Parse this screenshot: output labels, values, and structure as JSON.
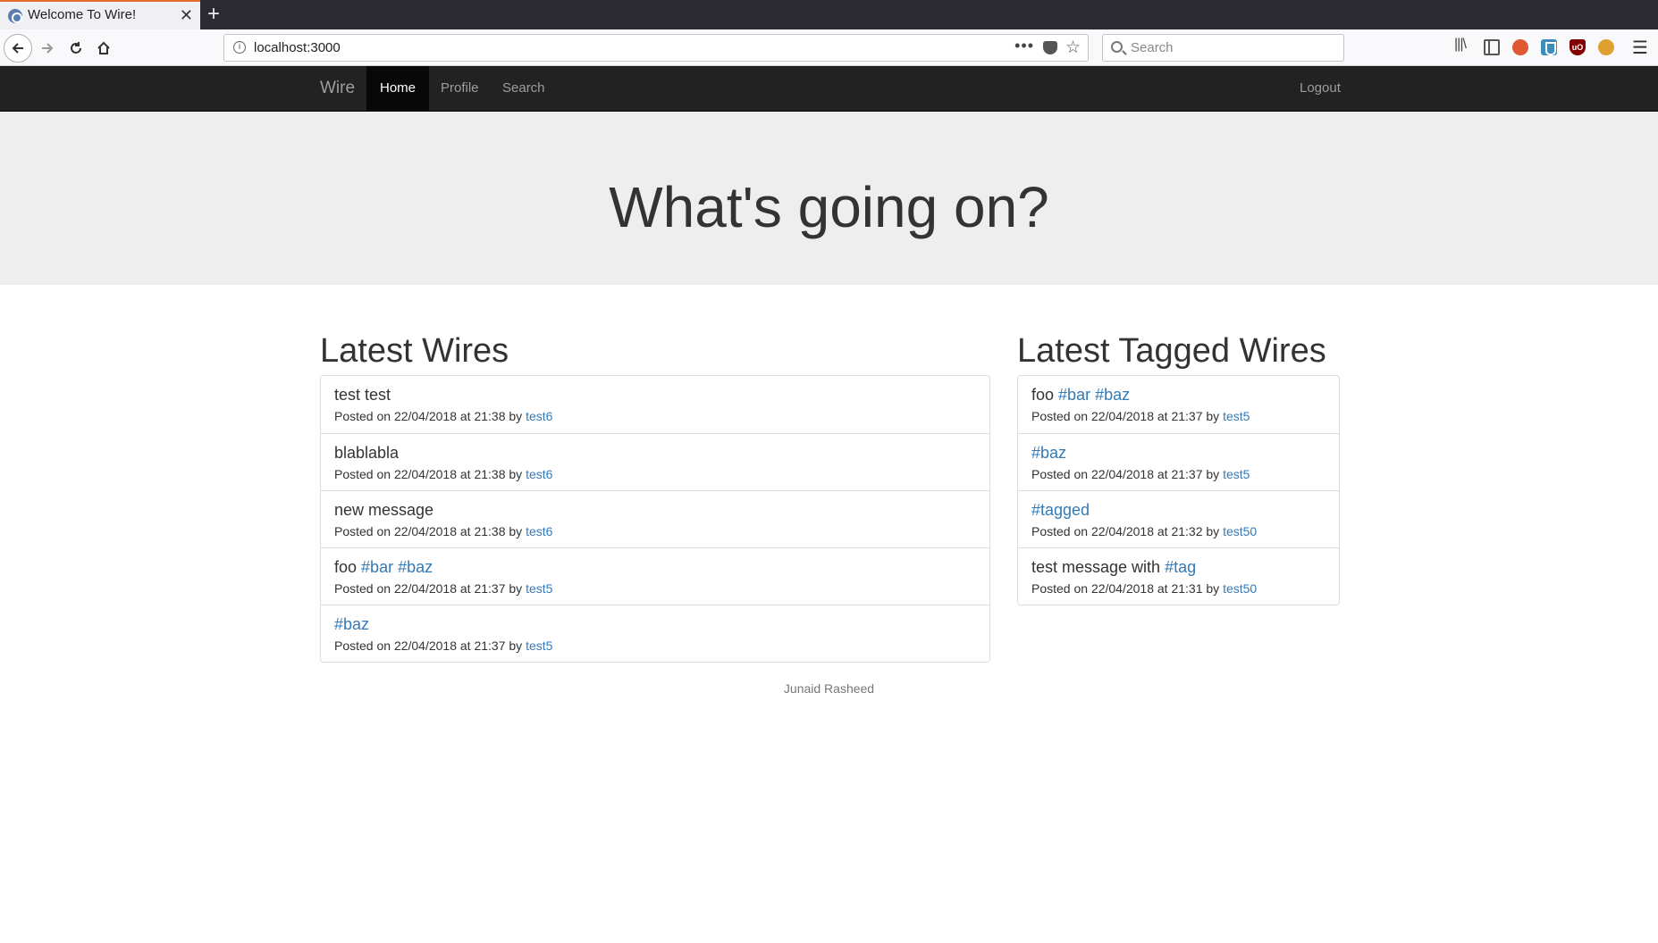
{
  "browser": {
    "tab_title": "Welcome To Wire!",
    "url": "localhost:3000",
    "search_placeholder": "Search",
    "url_more": "•••",
    "new_tab": "+",
    "close": "✕"
  },
  "site_nav": {
    "brand": "Wire",
    "items": [
      "Home",
      "Profile",
      "Search"
    ],
    "active": "Home",
    "logout": "Logout"
  },
  "hero": {
    "title": "What's going on?"
  },
  "latest_wires": {
    "title": "Latest Wires",
    "items": [
      {
        "text": "test test",
        "tags": [],
        "date": "22/04/2018",
        "time": "21:38",
        "author": "test6"
      },
      {
        "text": "blablabla",
        "tags": [],
        "date": "22/04/2018",
        "time": "21:38",
        "author": "test6"
      },
      {
        "text": "new message",
        "tags": [],
        "date": "22/04/2018",
        "time": "21:38",
        "author": "test6"
      },
      {
        "text": "foo",
        "tags": [
          "#bar",
          "#baz"
        ],
        "date": "22/04/2018",
        "time": "21:37",
        "author": "test5"
      },
      {
        "text": "",
        "tags": [
          "#baz"
        ],
        "date": "22/04/2018",
        "time": "21:37",
        "author": "test5"
      }
    ]
  },
  "latest_tagged": {
    "title": "Latest Tagged Wires",
    "items": [
      {
        "text": "foo",
        "tags": [
          "#bar",
          "#baz"
        ],
        "date": "22/04/2018",
        "time": "21:37",
        "author": "test5"
      },
      {
        "text": "",
        "tags": [
          "#baz"
        ],
        "date": "22/04/2018",
        "time": "21:37",
        "author": "test5"
      },
      {
        "text": "",
        "tags": [
          "#tagged"
        ],
        "date": "22/04/2018",
        "time": "21:32",
        "author": "test50"
      },
      {
        "text": "test message with",
        "tags": [
          "#tag"
        ],
        "date": "22/04/2018",
        "time": "21:31",
        "author": "test50"
      }
    ]
  },
  "footer": {
    "text": "Junaid Rasheed"
  }
}
